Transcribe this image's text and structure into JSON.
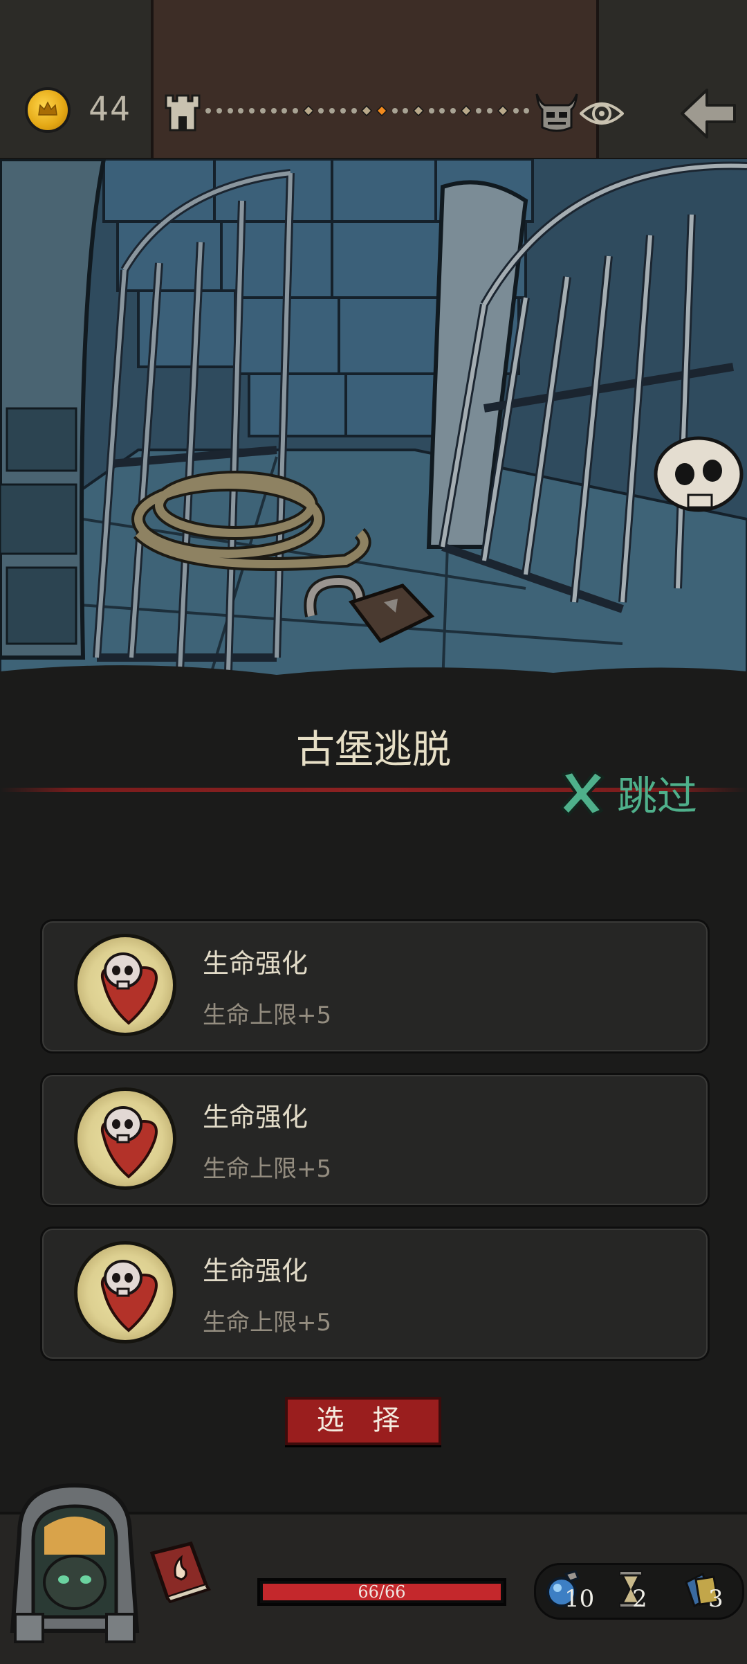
{
  "header": {
    "coins": "44",
    "icons": {
      "coin": "crown-coin-icon",
      "castle": "castle-tower-icon",
      "boss": "horned-boss-icon",
      "eye": "spiral-eye-icon",
      "back": "back-arrow-icon"
    },
    "path_nodes": [
      "dot",
      "dot",
      "dot",
      "dot",
      "dot",
      "dot",
      "dot",
      "dot",
      "dot",
      "diamond",
      "dot",
      "dot",
      "dot",
      "dot",
      "diamond",
      "current",
      "dot",
      "dot",
      "diamond",
      "dot",
      "dot",
      "dot",
      "diamond",
      "dot",
      "dot",
      "diamond",
      "dot",
      "dot"
    ],
    "current_node_color": "#f28a1e"
  },
  "event": {
    "title": "古堡逃脱",
    "skip_label": "跳过"
  },
  "options": [
    {
      "title": "生命强化",
      "desc": "生命上限+5",
      "icon": "skull-heart-icon"
    },
    {
      "title": "生命强化",
      "desc": "生命上限+5",
      "icon": "skull-heart-icon"
    },
    {
      "title": "生命强化",
      "desc": "生命上限+5",
      "icon": "skull-heart-icon"
    }
  ],
  "select_label": "选 择",
  "footer": {
    "hp_text": "66/66",
    "hp_fraction": 1.0,
    "resources": [
      {
        "name": "potion",
        "icon": "potion-flask-icon",
        "count": "10"
      },
      {
        "name": "hourglass",
        "icon": "hourglass-icon",
        "count": "2"
      },
      {
        "name": "cards",
        "icon": "cards-icon",
        "count": "3"
      }
    ]
  },
  "colors": {
    "accent_red": "#9a1e1e",
    "skip_green": "#4fb08b",
    "hp_red": "#c4282c",
    "coin_gold": "#e3a714"
  }
}
